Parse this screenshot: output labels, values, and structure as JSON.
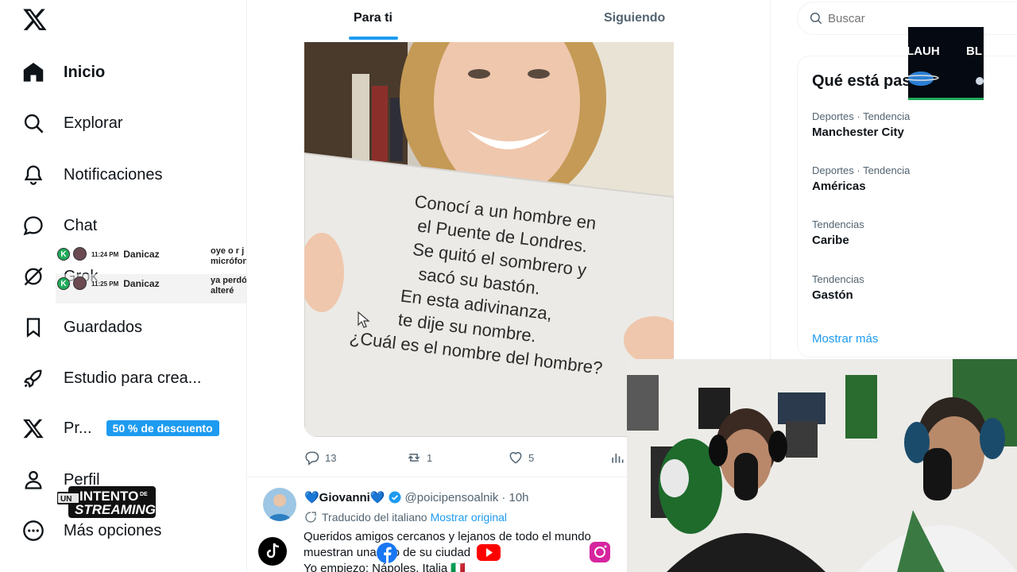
{
  "sidebar": {
    "items": [
      {
        "label": "Inicio",
        "icon": "home-icon"
      },
      {
        "label": "Explorar",
        "icon": "search-icon"
      },
      {
        "label": "Notificaciones",
        "icon": "bell-icon"
      },
      {
        "label": "Chat",
        "icon": "chat-icon"
      },
      {
        "label": "Grok",
        "icon": "grok-icon"
      },
      {
        "label": "Guardados",
        "icon": "bookmark-icon"
      },
      {
        "label": "Estudio para crea...",
        "icon": "rocket-icon"
      },
      {
        "label": "Pr...",
        "icon": "x-icon",
        "badge": "50 % de descuento"
      },
      {
        "label": "Perfil",
        "icon": "person-icon"
      },
      {
        "label": "Más opciones",
        "icon": "more-icon"
      }
    ]
  },
  "chat_overlay": {
    "messages": [
      {
        "badge": "K",
        "time": "11:24 PM",
        "user": "Danicaz",
        "text": "oye o r j y el micrófono??"
      },
      {
        "badge": "K",
        "time": "11:25 PM",
        "user": "Danicaz",
        "text": "ya perdón, me alteré"
      }
    ]
  },
  "overlay_logo": {
    "line1": "UN",
    "line2": "INTENTO",
    "line2b": "DE",
    "line3": "STREAMING"
  },
  "tabs": {
    "for_you": "Para ti",
    "following": "Siguiendo"
  },
  "tweet1": {
    "sign_lines": [
      "Conocí a un hombre en",
      "el Puente de Londres.",
      "Se quitó el sombrero y",
      "sacó su bastón.",
      "En esta adivinanza,",
      "te dije su nombre.",
      "¿Cuál es el nombre del hombre?"
    ],
    "replies": "13",
    "retweets": "1",
    "likes": "5"
  },
  "tweet2": {
    "name": "💙Giovanni💙",
    "handle": "@poicipensoalnik",
    "time": "· 10h",
    "translated": "Traducido del italiano",
    "show_original": "Mostrar original",
    "text_line1": "Queridos amigos cercanos y lejanos de todo el mundo",
    "text_line2": "muestran una foto de su ciudad",
    "text_line3": "Yo empiezo: Nápoles, Italia 🇮🇹"
  },
  "search": {
    "placeholder": "Buscar"
  },
  "trends": {
    "title": "Qué está pasando",
    "items": [
      {
        "meta": "Deportes · Tendencia",
        "name": "Manchester City"
      },
      {
        "meta": "Deportes · Tendencia",
        "name": "Américas"
      },
      {
        "meta": "Tendencias",
        "name": "Caribe"
      },
      {
        "meta": "Tendencias",
        "name": "Gastón"
      }
    ],
    "show_more": "Mostrar más"
  },
  "stream_widget": {
    "left_text": "LAUH",
    "right_text": "BL"
  },
  "colors": {
    "accent": "#1d9bf0",
    "text": "#0f1419",
    "muted": "#536471",
    "chat_green": "#1faa5a"
  }
}
